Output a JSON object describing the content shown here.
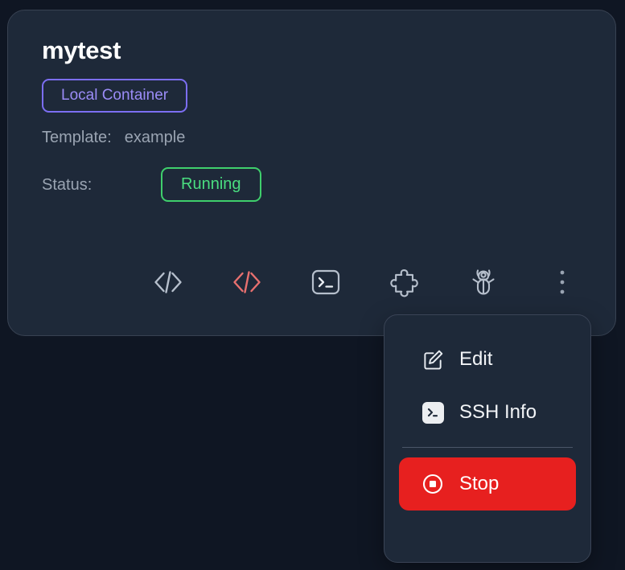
{
  "theme": {
    "page_bg": "#0f1623",
    "card_bg": "#1e2939",
    "card_border": "#384252",
    "accent_purple": "#7c6ef2",
    "accent_purple_text": "#9b8cf7",
    "accent_green": "#4ade80",
    "accent_red": "#e7201f",
    "muted_text": "#9aa4b2",
    "icon_gray": "#b6bfcc",
    "icon_red": "#e8706f"
  },
  "card": {
    "title": "mytest",
    "type_badge": "Local Container",
    "template_label": "Template:",
    "template_value": "example",
    "status_label": "Status:",
    "status_value": "Running",
    "toolbar": [
      {
        "name": "code-icon",
        "title": "Open in Code"
      },
      {
        "name": "code-red-icon",
        "title": "Open in Code (Insiders)"
      },
      {
        "name": "terminal-icon",
        "title": "Open Terminal"
      },
      {
        "name": "puzzle-icon",
        "title": "Extensions"
      },
      {
        "name": "bug-icon",
        "title": "Debug"
      },
      {
        "name": "kebab-menu-icon",
        "title": "More actions"
      }
    ]
  },
  "menu": {
    "items": [
      {
        "label": "Edit",
        "icon": "pencil-square-icon"
      },
      {
        "label": "SSH Info",
        "icon": "ssh-prompt-icon"
      }
    ],
    "action": {
      "label": "Stop",
      "icon": "stop-circle-icon"
    }
  }
}
